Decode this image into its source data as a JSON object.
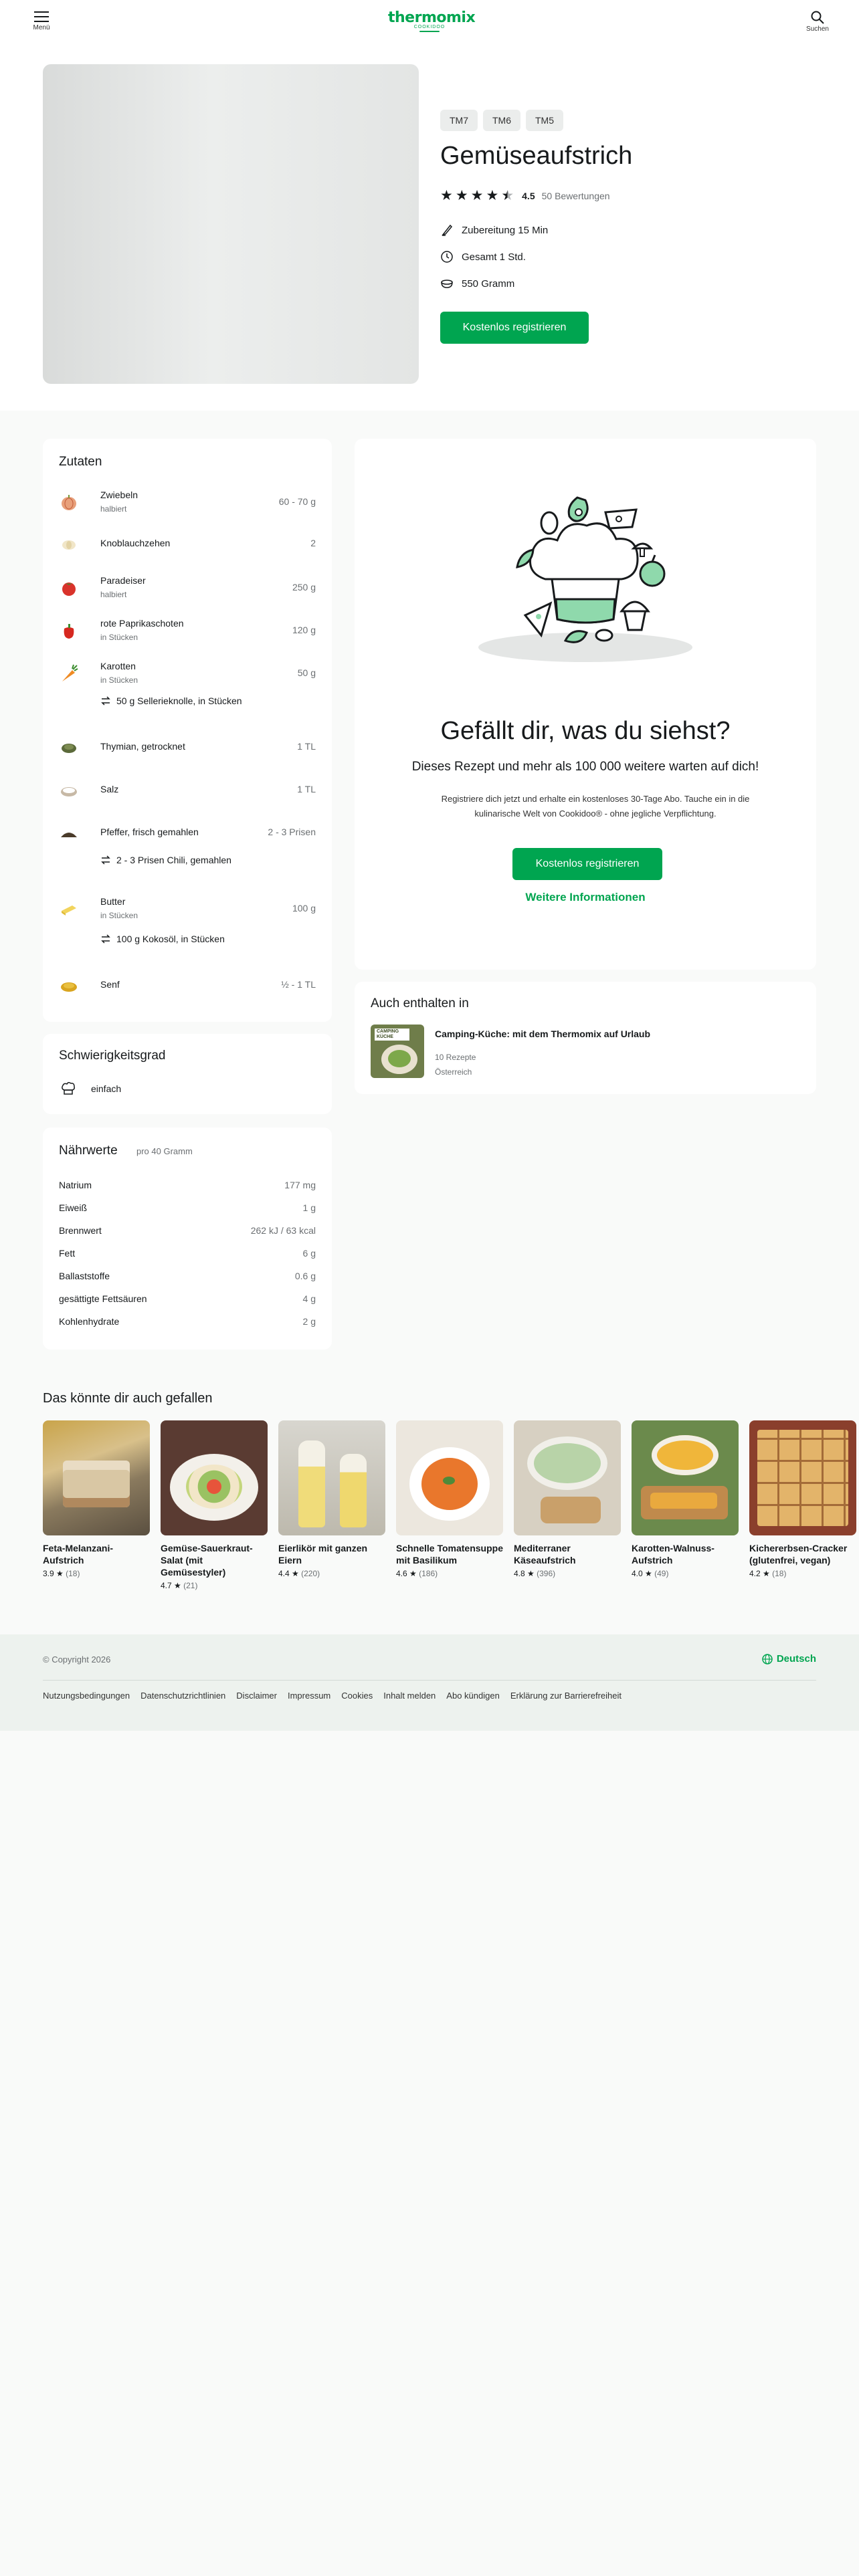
{
  "header": {
    "menu_label": "Menü",
    "logo": "thermomix",
    "logo_sub": "COOKIDOO",
    "search_label": "Suchen"
  },
  "recipe": {
    "devices": [
      "TM7",
      "TM6",
      "TM5"
    ],
    "title": "Gemüseaufstrich",
    "rating": "4.5",
    "rating_count": "50 Bewertungen",
    "prep": "Zubereitung 15 Min",
    "total": "Gesamt 1 Std.",
    "yield": "550 Gramm",
    "register_label": "Kostenlos registrieren"
  },
  "ingredients": {
    "title": "Zutaten",
    "items": [
      {
        "name": "Zwiebeln",
        "sub": "halbiert",
        "qty": "60 - 70 g",
        "icon": "onion-icon"
      },
      {
        "name": "Knoblauchzehen",
        "sub": "",
        "qty": "2",
        "icon": "garlic-icon"
      },
      {
        "name": "Paradeiser",
        "sub": "halbiert",
        "qty": "250 g",
        "icon": "tomato-icon"
      },
      {
        "name": "rote Paprikaschoten",
        "sub": "in Stücken",
        "qty": "120 g",
        "icon": "pepper-icon"
      },
      {
        "name": "Karotten",
        "sub": "in Stücken",
        "qty": "50 g",
        "icon": "carrot-icon",
        "alt": "50 g Sellerieknolle, in Stücken"
      },
      {
        "name": "Thymian, getrocknet",
        "sub": "",
        "qty": "1 TL",
        "icon": "thyme-icon"
      },
      {
        "name": "Salz",
        "sub": "",
        "qty": "1 TL",
        "icon": "salt-icon"
      },
      {
        "name": "Pfeffer, frisch gemahlen",
        "sub": "",
        "qty": "2 - 3 Prisen",
        "icon": "pepper-ground-icon",
        "alt": "2 - 3 Prisen Chili, gemahlen"
      },
      {
        "name": "Butter",
        "sub": "in Stücken",
        "qty": "100 g",
        "icon": "butter-icon",
        "alt": "100 g Kokosöl, in Stücken"
      },
      {
        "name": "Senf",
        "sub": "",
        "qty": "½ - 1 TL",
        "icon": "mustard-icon"
      }
    ]
  },
  "difficulty": {
    "title": "Schwierigkeitsgrad",
    "value": "einfach"
  },
  "nutrition": {
    "title": "Nährwerte",
    "per": "pro 40 Gramm",
    "rows": [
      {
        "label": "Natrium",
        "value": "177 mg"
      },
      {
        "label": "Eiweiß",
        "value": "1 g"
      },
      {
        "label": "Brennwert",
        "value": "262 kJ / 63 kcal"
      },
      {
        "label": "Fett",
        "value": "6 g"
      },
      {
        "label": "Ballaststoffe",
        "value": "0.6 g"
      },
      {
        "label": "gesättigte Fettsäuren",
        "value": "4 g"
      },
      {
        "label": "Kohlenhydrate",
        "value": "2 g"
      }
    ]
  },
  "promo": {
    "title": "Gefällt dir, was du siehst?",
    "subtitle": "Dieses Rezept und mehr als 100 000 weitere warten auf dich!",
    "text": "Registriere dich jetzt und erhalte ein kostenloses 30-Tage Abo. Tauche ein in die kulinarische Welt von Cookidoo® - ohne jegliche Verpflichtung.",
    "register_label": "Kostenlos registrieren",
    "more_label": "Weitere Informationen"
  },
  "collections": {
    "title": "Auch enthalten in",
    "item_title": "Camping-Küche: mit dem Thermomix auf Urlaub",
    "item_count": "10 Rezepte",
    "item_region": "Österreich",
    "thumb_text": "CAMPING KÜCHE"
  },
  "recommendations": {
    "title": "Das könnte dir auch gefallen",
    "items": [
      {
        "title": "Feta-Melanzani-Aufstrich",
        "rating": "3.9",
        "count": "(18)"
      },
      {
        "title": "Gemüse-Sauerkraut-Salat (mit Gemüsestyler)",
        "rating": "4.7",
        "count": "(21)"
      },
      {
        "title": "Eierlikör mit ganzen Eiern",
        "rating": "4.4",
        "count": "(220)"
      },
      {
        "title": "Schnelle Tomatensuppe mit Basilikum",
        "rating": "4.6",
        "count": "(186)"
      },
      {
        "title": "Mediterraner Käseaufstrich",
        "rating": "4.8",
        "count": "(396)"
      },
      {
        "title": "Karotten-Walnuss-Aufstrich",
        "rating": "4.0",
        "count": "(49)"
      },
      {
        "title": "Kichererbsen-Cracker (glutenfrei, vegan)",
        "rating": "4.2",
        "count": "(18)"
      }
    ]
  },
  "footer": {
    "copyright": "© Copyright 2026",
    "language": "Deutsch",
    "links": [
      "Nutzungsbedingungen",
      "Datenschutzrichtlinien",
      "Disclaimer",
      "Impressum",
      "Cookies",
      "Inhalt melden",
      "Abo kündigen",
      "Erklärung zur Barrierefreiheit"
    ]
  },
  "colors": {
    "brand_green": "#00a550",
    "page_bg": "#f9faf9",
    "footer_bg": "#edf2ee"
  }
}
